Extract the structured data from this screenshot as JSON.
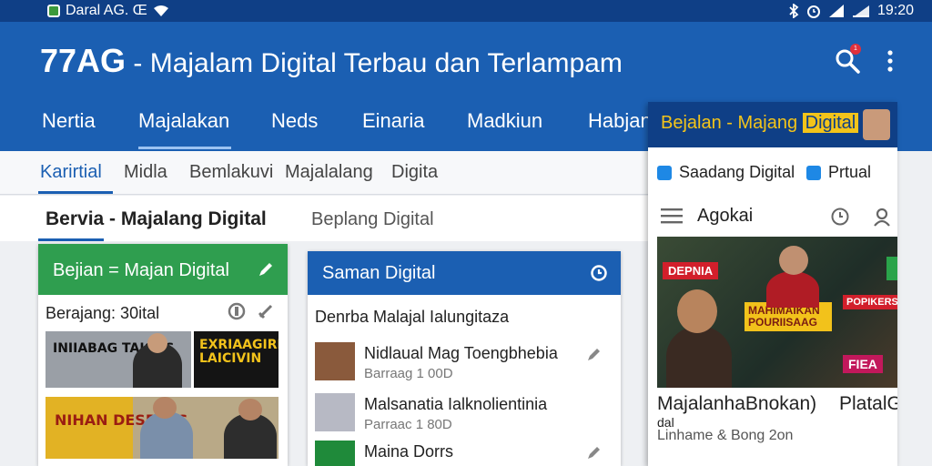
{
  "status_bar": {
    "left_text": "Daral AG. Œ",
    "time": "19:20"
  },
  "app_bar": {
    "title_brand": "77AG",
    "title_rest": " - Majalam Digital Terbau dan Terlampam",
    "notification_count": "1"
  },
  "nav_tabs": [
    {
      "label": "Nertia"
    },
    {
      "label": "Majalakan"
    },
    {
      "label": "Neds"
    },
    {
      "label": "Einaria"
    },
    {
      "label": "Madkiun"
    },
    {
      "label": "Habjan"
    }
  ],
  "sub_tabs": [
    {
      "label": "Karirtial"
    },
    {
      "label": "Midla"
    },
    {
      "label": "Bemlakuvi"
    },
    {
      "label": "Majalalang"
    },
    {
      "label": "Digita"
    }
  ],
  "section": {
    "title": "Bervia - Majalang Digital",
    "subtitle": "Beplang Digital"
  },
  "card_green": {
    "title": "Bejian = Majan Digital",
    "subtitle": "Berajang: 30ital",
    "thumb1_text": "INIIABAG TAIGUS",
    "thumb2_text": "EXRIAAGIRE LAICIVIN",
    "thumb3_text": "NIHAN DESPAUS"
  },
  "card_blue": {
    "title": "Saman Digital",
    "subtitle": "Denrba Malajal Ialungitaza",
    "rows": [
      {
        "title": "Nidlaual Mag Toengbhebia",
        "meta": "Barraag 1 00D"
      },
      {
        "title": "Malsanatia Ialknolientinia",
        "meta": "Parraac 1 80D"
      },
      {
        "title": "Maina Dorrs",
        "meta": ""
      }
    ]
  },
  "side_panel": {
    "title_plain": "Bejalan - Majang ",
    "title_highlight": "Digital",
    "check1": "Saadang Digital",
    "check2": "Prtual",
    "toolbar_label": "Agokai",
    "hero_tag1": "DEPNIA",
    "hero_tag2": "MAHIMAIKAN POURIISAAG",
    "hero_tag3": "POPIKERS",
    "hero_tag4": "FIEA",
    "caption1": "MajalanhaBnokan)",
    "caption2": "PlatalG",
    "caption_small": "dal",
    "caption_meta": "Linhame & Bong 2on"
  },
  "colors": {
    "app_bar": "#1b5fb2",
    "status_bar": "#0f3f86",
    "green_card": "#2f9e4f",
    "accent_yellow": "#f3c41a"
  }
}
